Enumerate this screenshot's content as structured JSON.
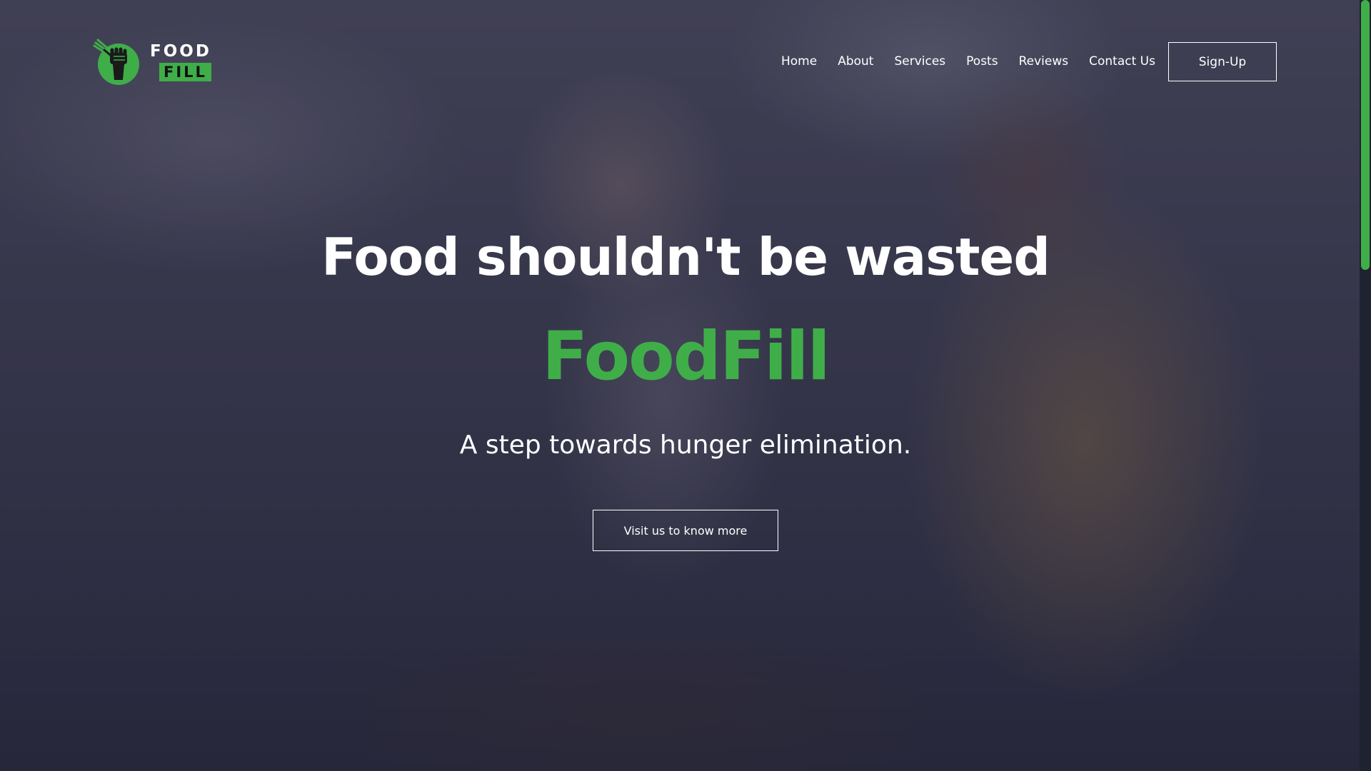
{
  "header": {
    "logo": {
      "icon": "raised-fist-fork-icon",
      "line1": "FOOD",
      "line2": "FILL"
    },
    "nav": [
      {
        "label": "Home"
      },
      {
        "label": "About"
      },
      {
        "label": "Services"
      },
      {
        "label": "Posts"
      },
      {
        "label": "Reviews"
      },
      {
        "label": "Contact Us"
      }
    ],
    "signup_label": "Sign-Up"
  },
  "hero": {
    "title": "Food shouldn't be wasted",
    "brand": "FoodFill",
    "tagline": "A step towards hunger elimination.",
    "cta_label": "Visit us to know more"
  },
  "colors": {
    "accent": "#3fae49",
    "text": "#ffffff",
    "overlay": "#222440"
  }
}
